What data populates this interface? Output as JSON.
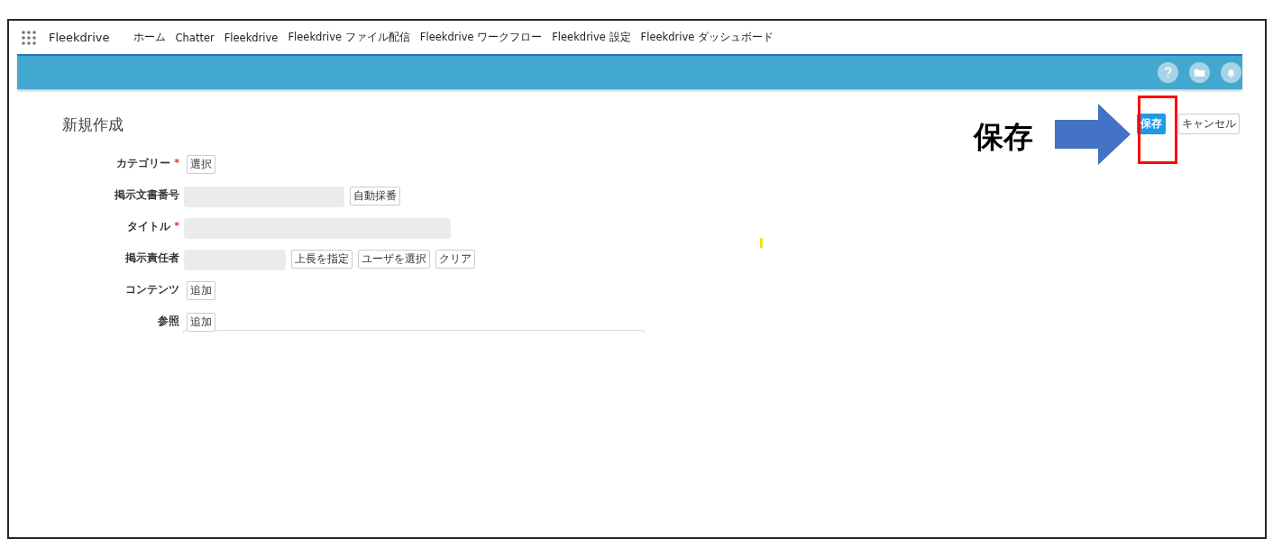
{
  "app": {
    "name": "Fleekdrive"
  },
  "nav": [
    {
      "label": "ホーム"
    },
    {
      "label": "Chatter"
    },
    {
      "label": "Fleekdrive"
    },
    {
      "label": "Fleekdrive ファイル配信"
    },
    {
      "label": "Fleekdrive ワークフロー"
    },
    {
      "label": "Fleekdrive 設定"
    },
    {
      "label": "Fleekdrive ダッシュボード"
    }
  ],
  "page": {
    "title": "新規作成",
    "actions": [
      {
        "label": "保存",
        "kind": "primary"
      },
      {
        "label": "キャンセル",
        "kind": "neutral"
      }
    ]
  },
  "form": [
    {
      "label": "カテゴリー",
      "marker": "*",
      "kind": "buttons",
      "buttons": [
        "選択"
      ]
    },
    {
      "label": "掲示文書番号",
      "kind": "short_input",
      "buttons": [
        "自動採番"
      ]
    },
    {
      "label": "タイトル",
      "marker": "*",
      "kind": "long_input"
    },
    {
      "label": "掲示責任者",
      "kind": "tiny_input",
      "buttons": [
        "上長を指定",
        "ユーザを選択",
        "クリア"
      ]
    },
    {
      "label": "コンテンツ",
      "kind": "buttons",
      "buttons": [
        "追加"
      ]
    },
    {
      "label": "参照",
      "kind": "buttons",
      "buttons": [
        "追加"
      ]
    }
  ],
  "annotation": {
    "text": "保存"
  }
}
